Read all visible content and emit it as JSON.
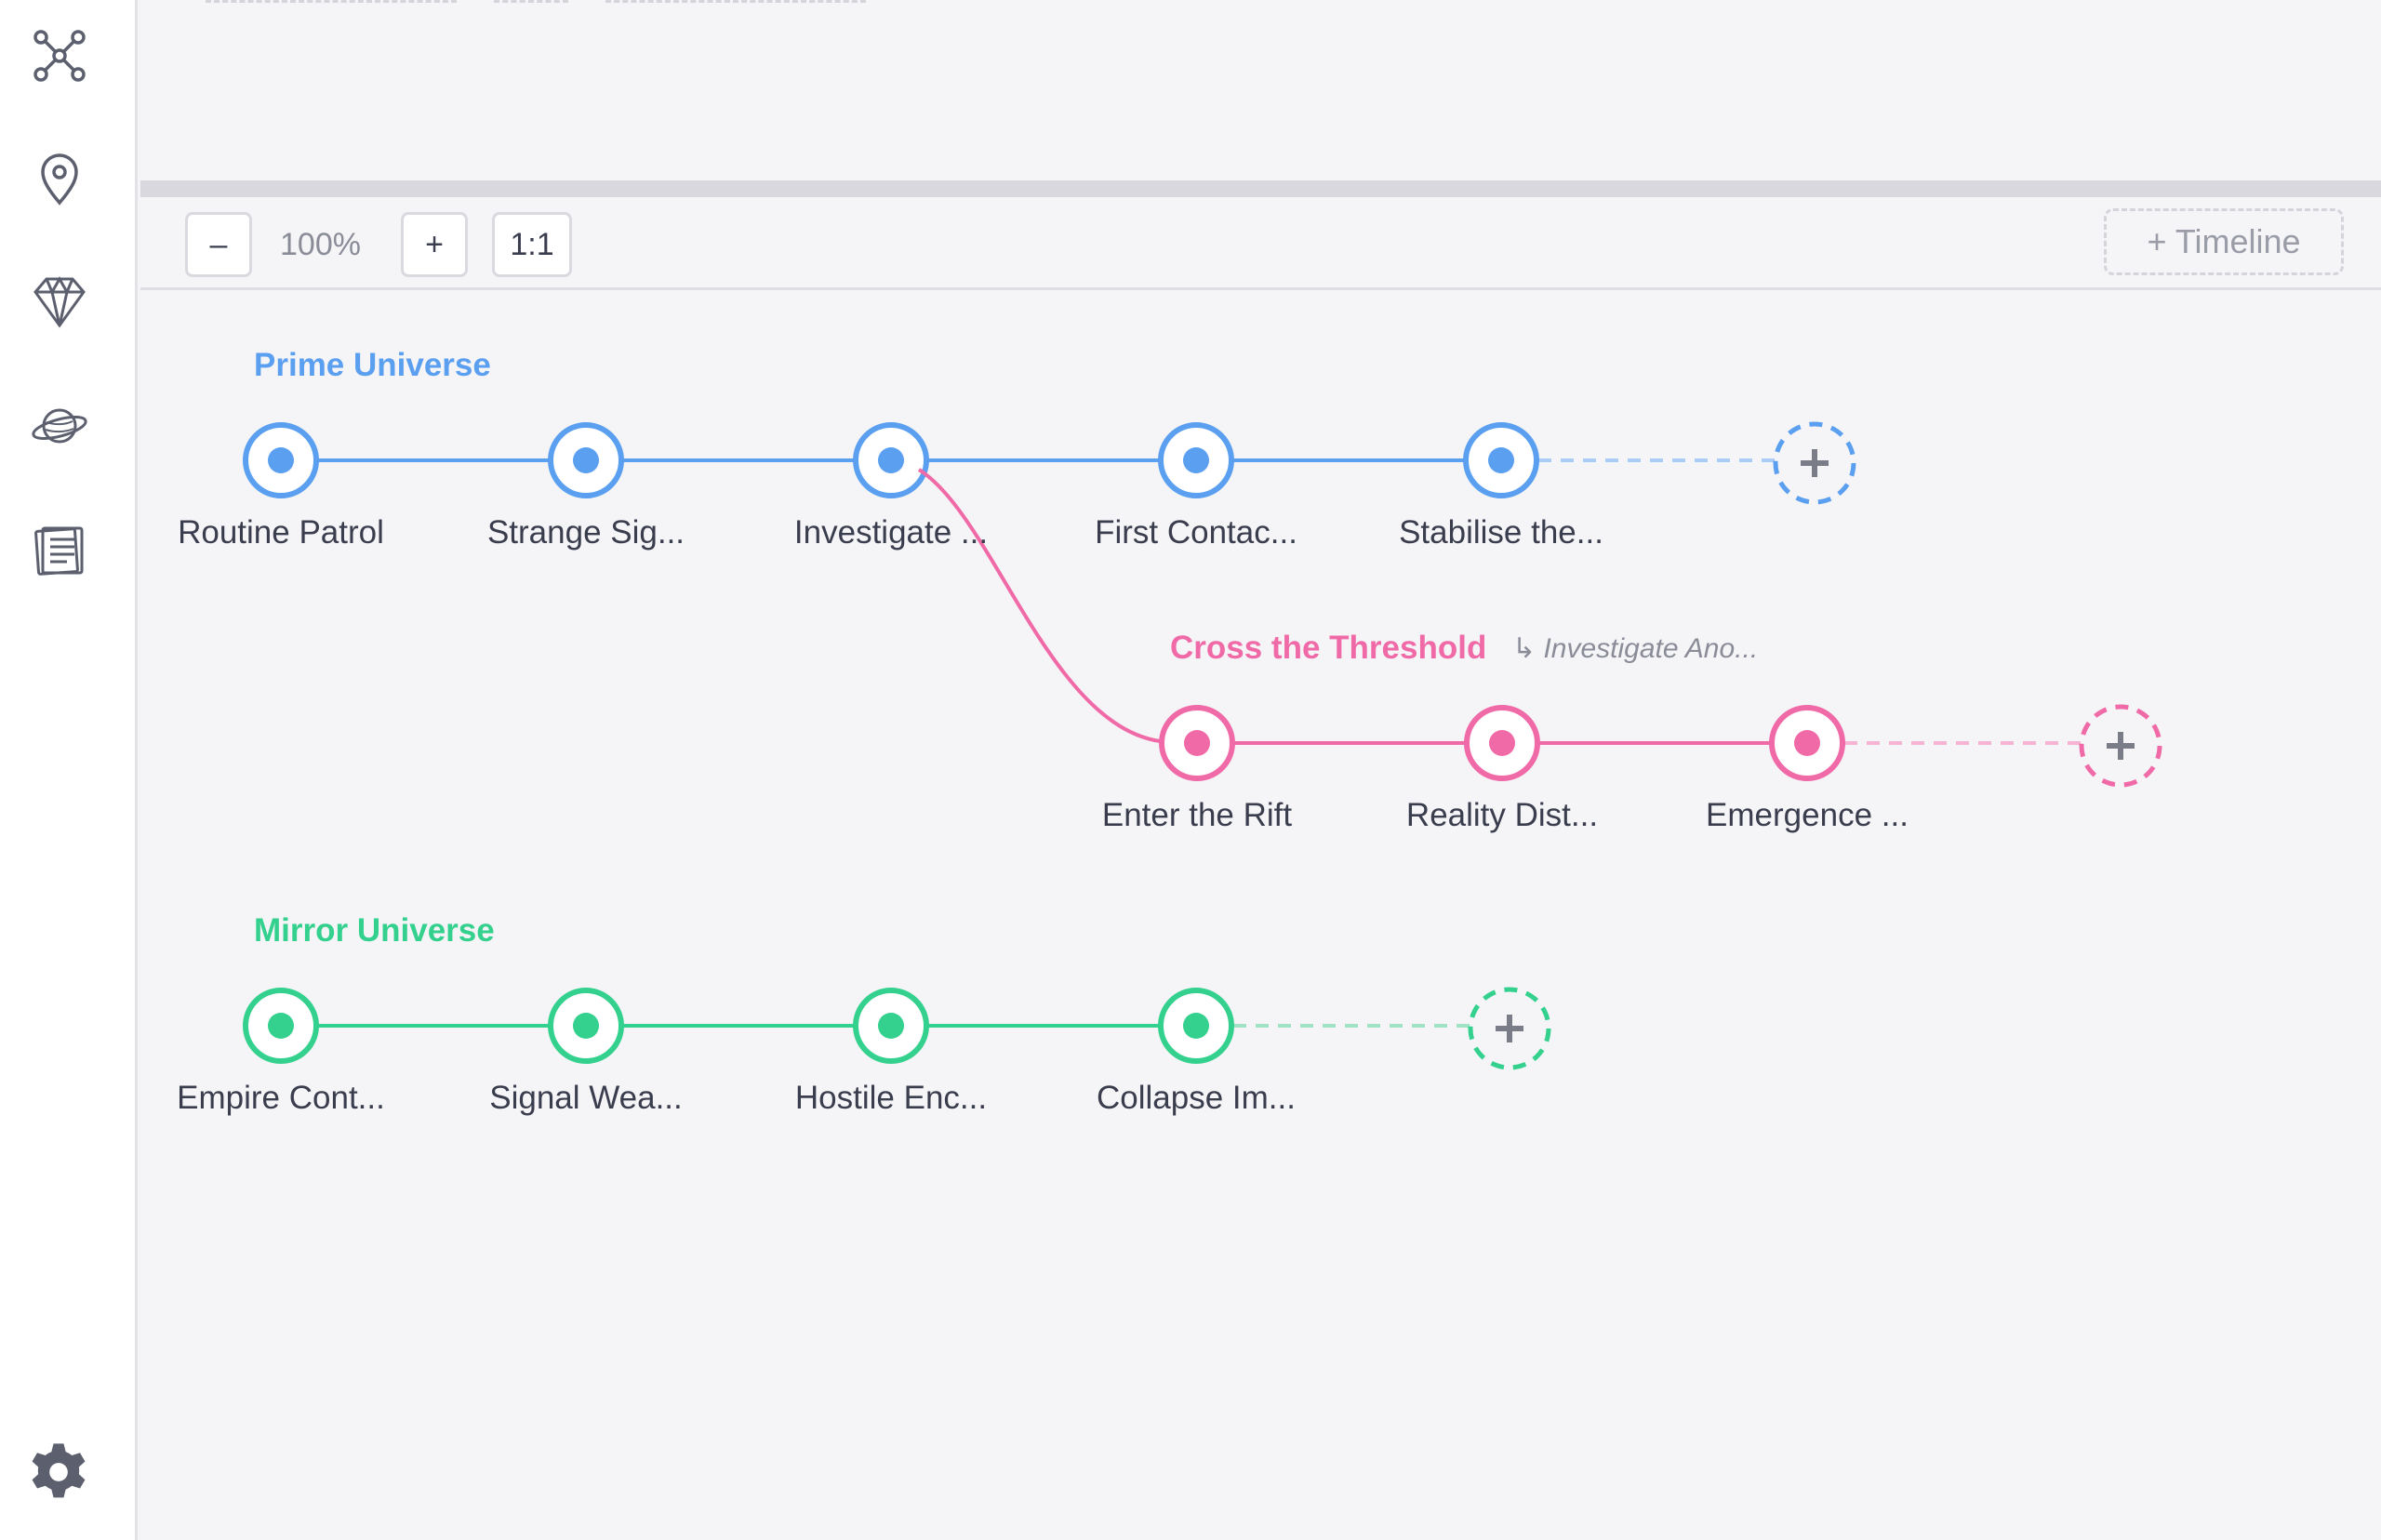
{
  "sidebar": {
    "items": [
      {
        "name": "graph-nodes-icon"
      },
      {
        "name": "map-pin-icon"
      },
      {
        "name": "diamond-icon"
      },
      {
        "name": "planet-icon"
      },
      {
        "name": "notes-icon"
      }
    ],
    "settings_icon": "gear-icon"
  },
  "toolbar": {
    "zoom_out_label": "–",
    "zoom_level": "100%",
    "zoom_in_label": "+",
    "reset_label": "1:1",
    "add_timeline_label": "+ Timeline"
  },
  "timelines": [
    {
      "title": "Prime Universe",
      "color": "#5b9ff0",
      "light_color": "#a9cdf6",
      "events": [
        "Routine Patrol",
        "Strange Sig...",
        "Investigate ...",
        "First Contac...",
        "Stabilise the..."
      ]
    },
    {
      "title": "Cross the Threshold",
      "branch_from": "↳ Investigate Ano...",
      "color": "#f06aa8",
      "light_color": "#f6b3d3",
      "events": [
        "Enter the Rift",
        "Reality Dist...",
        "Emergence ..."
      ]
    },
    {
      "title": "Mirror Universe",
      "color": "#34d08e",
      "light_color": "#9fe3c4",
      "events": [
        "Empire Cont...",
        "Signal Wea...",
        "Hostile Enc...",
        "Collapse Im..."
      ]
    }
  ],
  "colors": {
    "icon": "#6b6e7c",
    "add_plus": "#7a7c88"
  }
}
